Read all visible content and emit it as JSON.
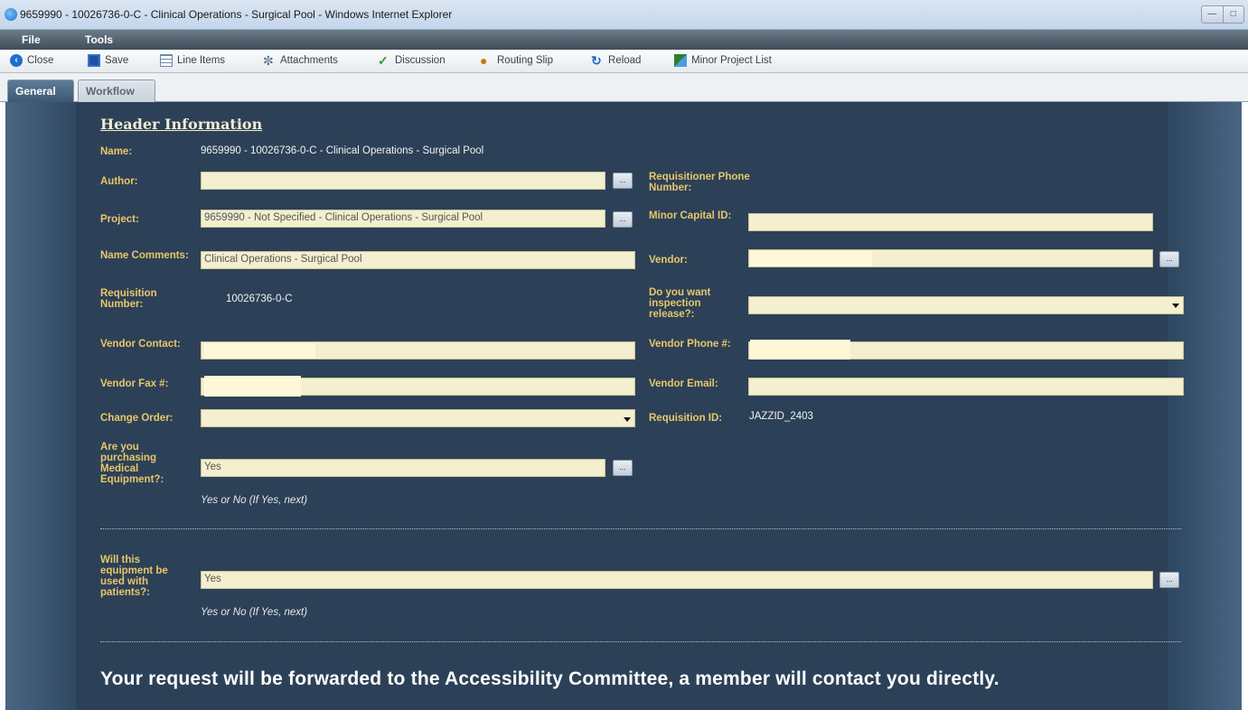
{
  "window": {
    "title": "9659990 - 10026736-0-C - Clinical Operations - Surgical Pool - Windows Internet Explorer"
  },
  "menu": {
    "items": [
      "File",
      "Tools"
    ]
  },
  "toolbar": {
    "close": "Close",
    "save": "Save",
    "line_items": "Line Items",
    "attachments": "Attachments",
    "discussion": "Discussion",
    "routing_slip": "Routing Slip",
    "reload": "Reload",
    "minor_project_list": "Minor Project List"
  },
  "tabs": [
    {
      "label": "General",
      "active": true
    },
    {
      "label": "Workflow",
      "active": false
    }
  ],
  "header": {
    "section_title": "Header Information",
    "name_label": "Name:",
    "name_value": "9659990 - 10026736-0-C - Clinical Operations - Surgical Pool",
    "author_label": "Author:",
    "author_value": "",
    "requisitioner_phone_label": "Requisitioner Phone Number:",
    "project_label": "Project:",
    "project_value": "9659990 - Not Specified - Clinical Operations - Surgical Pool",
    "minor_capital_label": "Minor Capital ID:",
    "minor_capital_value": "",
    "name_comments_label": "Name Comments:",
    "name_comments_value": "Clinical Operations - Surgical Pool",
    "vendor_label": "Vendor:",
    "requisition_number_label": "Requisition Number:",
    "requisition_number_value": "10026736-0-C",
    "inspection_label": "Do you want inspection release?:",
    "inspection_value": "",
    "vendor_contact_label": "Vendor Contact:",
    "vendor_phone_label": "Vendor Phone #:",
    "vendor_fax_label": "Vendor Fax #:",
    "vendor_email_label": "Vendor Email:",
    "change_order_label": "Change Order:",
    "change_order_value": "",
    "requisition_id_label": "Requisition ID:",
    "requisition_id_value": "JAZZID_2403",
    "medical_equipment_label": "Are you purchasing Medical Equipment?:",
    "medical_equipment_value": "Yes",
    "medical_equipment_hint": "Yes or No (If Yes, next)",
    "patients_label": "Will this equipment be used with patients?:",
    "patients_value": "Yes",
    "patients_hint": "Yes or No (If Yes, next)",
    "dots_button": "...",
    "message": "Your request will be forwarded to the Accessibility Committee, a member will contact you directly."
  },
  "colors": {
    "panel_background": "#2c4157",
    "label_color": "#e8c66a",
    "field_background": "#f3efcf",
    "menu_bar": "#4a5866"
  }
}
